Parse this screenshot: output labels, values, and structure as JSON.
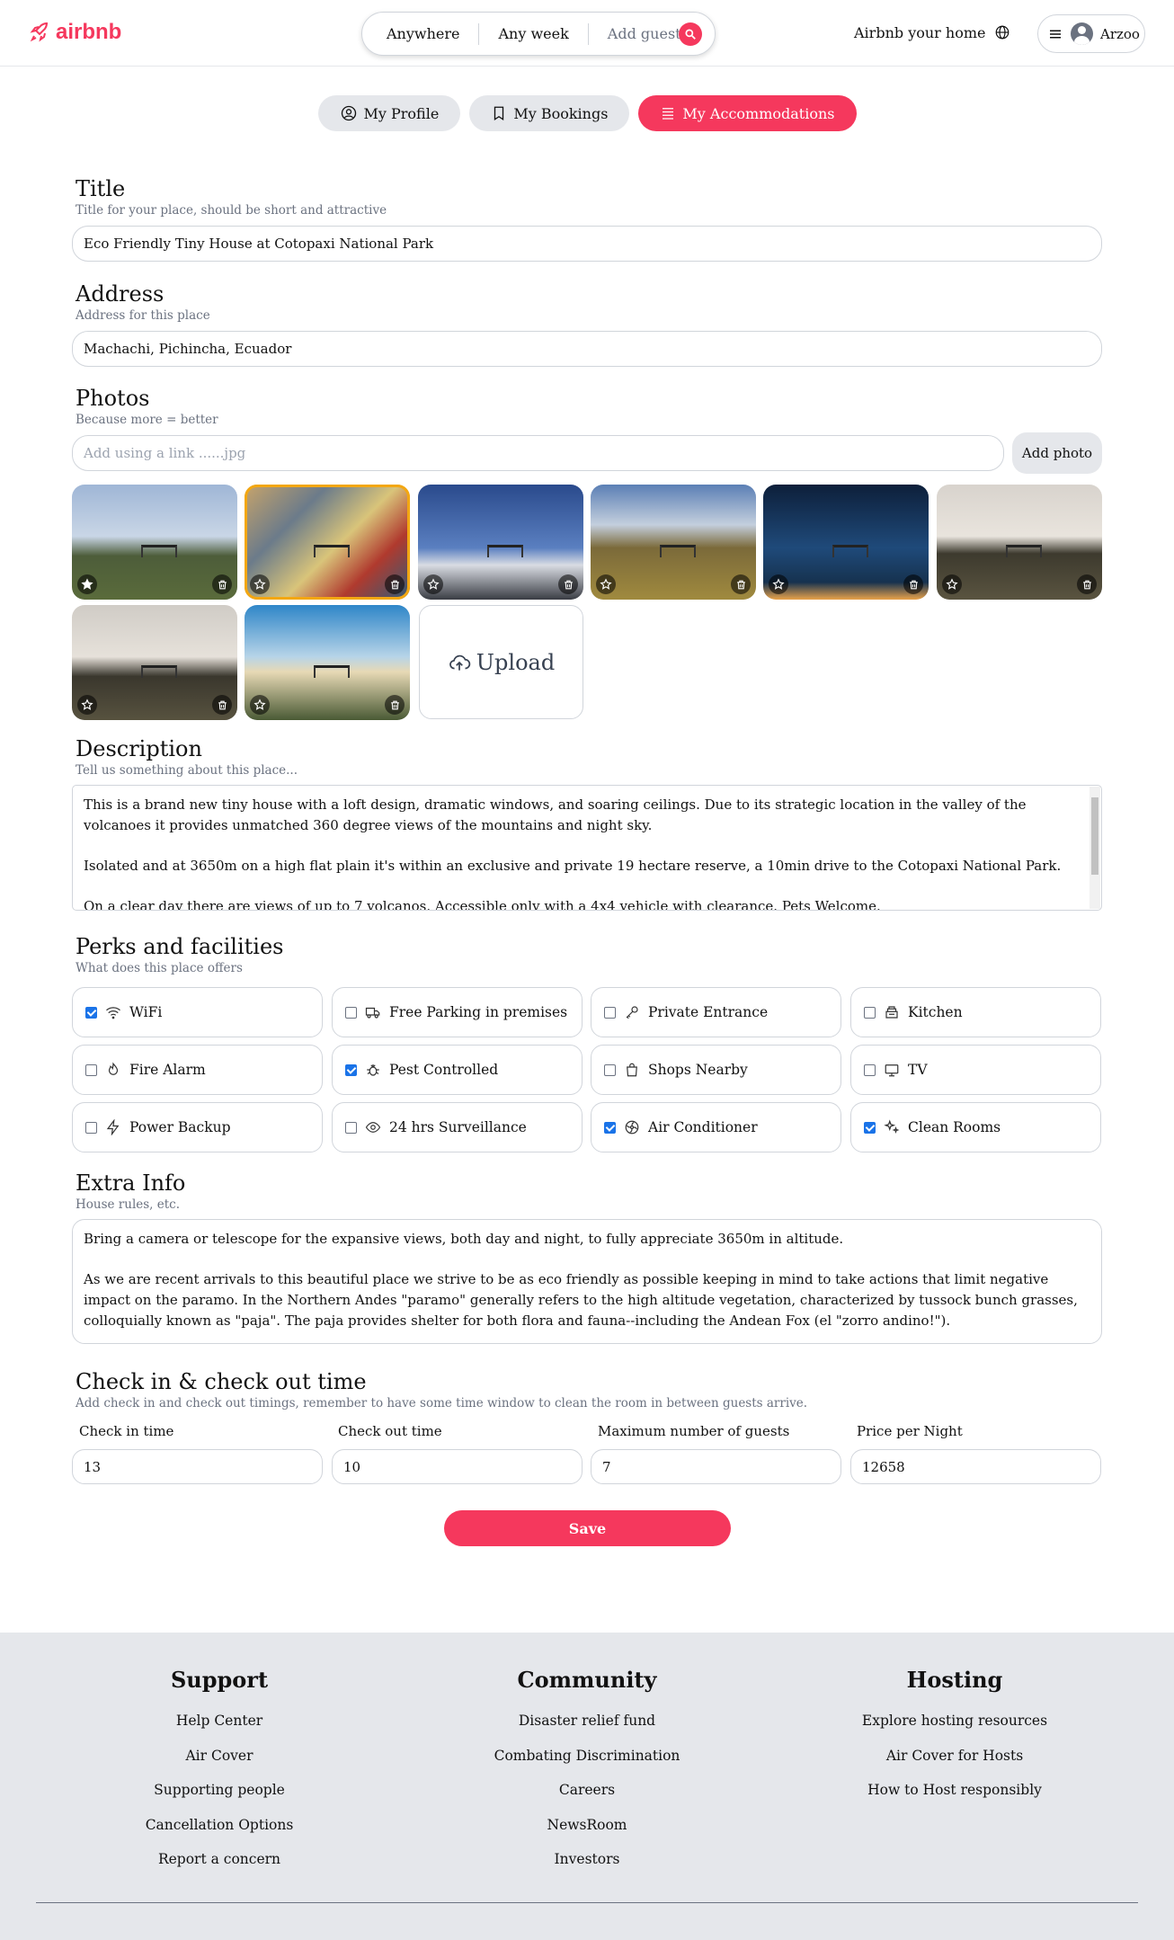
{
  "header": {
    "logo": "airbnb",
    "search": {
      "where": "Anywhere",
      "when": "Any week",
      "who": "Add guests"
    },
    "host_link": "Airbnb your home",
    "user_name": "Arzoo"
  },
  "tabs": [
    {
      "label": "My Profile"
    },
    {
      "label": "My Bookings"
    },
    {
      "label": "My Accommodations",
      "active": true
    }
  ],
  "form": {
    "title": {
      "heading": "Title",
      "hint": "Title for your place, should be short and attractive",
      "value": "Eco Friendly Tiny House at Cotopaxi National Park"
    },
    "address": {
      "heading": "Address",
      "hint": "Address for this place",
      "value": "Machachi, Pichincha, Ecuador"
    },
    "photos": {
      "heading": "Photos",
      "hint": "Because more = better",
      "placeholder": "Add using a link ......jpg",
      "add_label": "Add photo",
      "upload_label": "Upload",
      "count": 8
    },
    "description": {
      "heading": "Description",
      "hint": "Tell us something about this place...",
      "p1": "This is a brand new tiny house with a loft design, dramatic windows, and soaring ceilings. Due to its strategic location in the valley of the volcanoes it provides unmatched 360 degree views of the mountains and night sky.",
      "p2": "Isolated and at 3650m on a high flat plain it's within an exclusive and private 19 hectare reserve, a 10min drive to the Cotopaxi National Park.",
      "p3": "On a clear day there are views of up to 7 volcanos. Accessible only with a 4x4 vehicle with clearance. Pets Welcome."
    },
    "perks": {
      "heading": "Perks and facilities",
      "hint": "What does this place offers",
      "items": [
        {
          "label": "WiFi",
          "checked": true,
          "icon": "wifi-icon"
        },
        {
          "label": "Free Parking in premises",
          "checked": false,
          "icon": "truck-icon"
        },
        {
          "label": "Private Entrance",
          "checked": false,
          "icon": "key-icon"
        },
        {
          "label": "Kitchen",
          "checked": false,
          "icon": "kitchen-icon"
        },
        {
          "label": "Fire Alarm",
          "checked": false,
          "icon": "fire-icon"
        },
        {
          "label": "Pest Controlled",
          "checked": true,
          "icon": "bug-icon"
        },
        {
          "label": "Shops Nearby",
          "checked": false,
          "icon": "shopping-bag-icon"
        },
        {
          "label": "TV",
          "checked": false,
          "icon": "tv-icon"
        },
        {
          "label": "Power Backup",
          "checked": false,
          "icon": "bolt-icon"
        },
        {
          "label": "24 hrs Surveillance",
          "checked": false,
          "icon": "eye-icon"
        },
        {
          "label": "Air Conditioner",
          "checked": true,
          "icon": "fan-icon"
        },
        {
          "label": "Clean Rooms",
          "checked": true,
          "icon": "sparkles-icon"
        }
      ]
    },
    "extra": {
      "heading": "Extra Info",
      "hint": "House rules, etc.",
      "p1": "Bring a camera or telescope for the expansive views, both day and night, to fully appreciate 3650m in altitude.",
      "p2": "As we are recent arrivals to this beautiful place we strive to be as eco friendly as possible keeping in mind to take actions that limit negative impact on the paramo. In the Northern Andes \"paramo\" generally refers to the high altitude vegetation, characterized by tussock bunch grasses, colloquially known as \"paja\". The paja provides shelter for both flora and fauna--including the Andean Fox (el \"zorro andino!\")."
    },
    "checkin": {
      "heading": "Check in & check out time",
      "hint": "Add check in and check out timings, remember to have some time window to clean the room in between guests arrive.",
      "fields": [
        {
          "label": "Check in time",
          "value": "13"
        },
        {
          "label": "Check out time",
          "value": "10"
        },
        {
          "label": "Maximum number of guests",
          "value": "7"
        },
        {
          "label": "Price per Night",
          "value": "12658"
        }
      ]
    },
    "save_label": "Save"
  },
  "footer": {
    "support": {
      "title": "Support",
      "links": [
        "Help Center",
        "Air Cover",
        "Supporting people",
        "Cancellation Options",
        "Report a concern"
      ]
    },
    "community": {
      "title": "Community",
      "links": [
        "Disaster relief fund",
        "Combating Discrimination",
        "Careers",
        "NewsRoom",
        "Investors"
      ]
    },
    "hosting": {
      "title": "Hosting",
      "links": [
        "Explore hosting resources",
        "Air Cover for Hosts",
        "How to Host responsibly"
      ]
    }
  },
  "colors": {
    "brand": "#f5385d",
    "bg_footer": "#e5e7eb"
  }
}
